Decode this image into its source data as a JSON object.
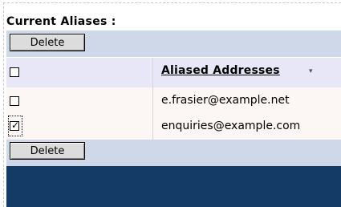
{
  "section": {
    "title": "Current Aliases :"
  },
  "toolbar_top": {
    "delete_label": "Delete"
  },
  "toolbar_bottom": {
    "delete_label": "Delete"
  },
  "table": {
    "header": {
      "select_all_checked": false,
      "column_label": "Aliased Addresses",
      "sort_icon": "sort-down-icon",
      "sort_glyph": "▾"
    },
    "rows": [
      {
        "address": "e.frasier@example.net",
        "checked": false
      },
      {
        "address": "enquiries@example.com",
        "checked": true
      }
    ]
  },
  "colors": {
    "toolbar_bg": "#cfd8e8",
    "header_bg": "#e8e7f7",
    "row_bg": "#fcf7f4",
    "footer_bg": "#143a66"
  },
  "check_glyph": "✓"
}
